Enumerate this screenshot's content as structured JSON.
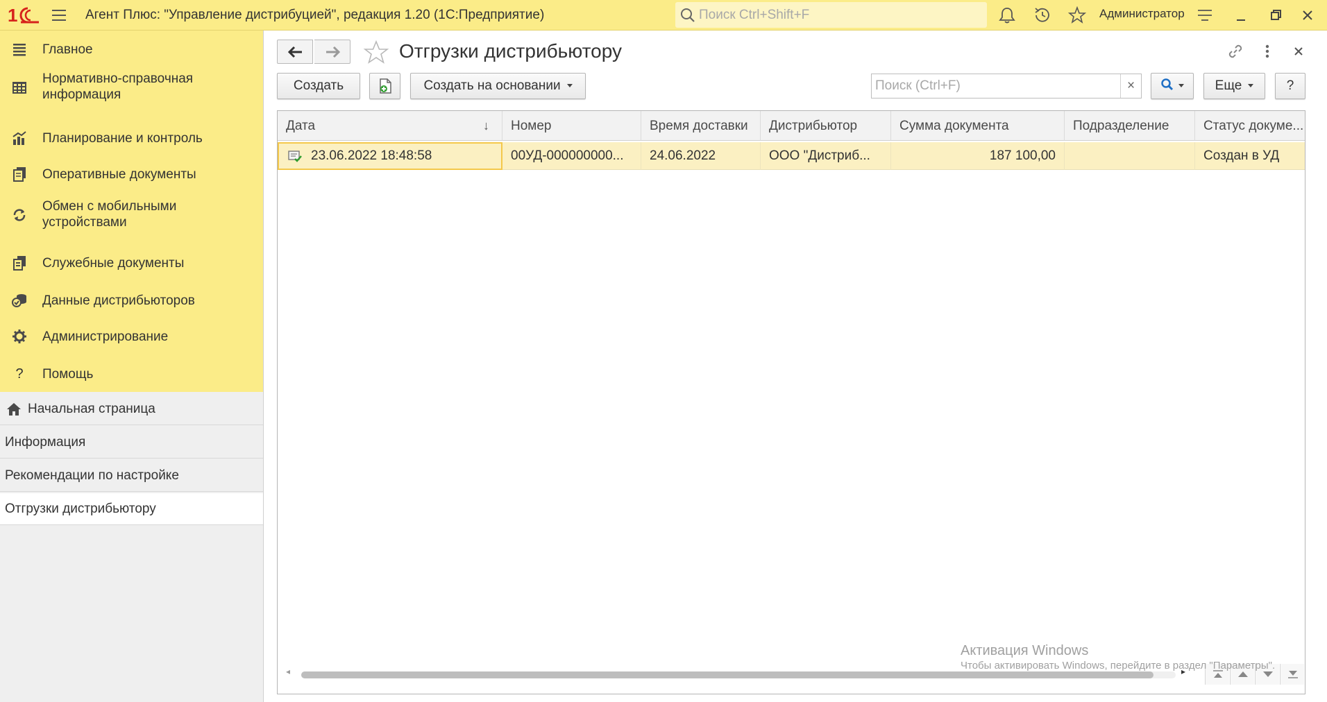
{
  "titlebar": {
    "logo_text": "1С",
    "app_title": "Агент Плюс: \"Управление дистрибуцией\", редакция 1.20  (1С:Предприятие)",
    "search_placeholder": "Поиск Ctrl+Shift+F",
    "user": "Администратор",
    "icons": [
      "menu-icon",
      "search-icon",
      "bell-icon",
      "history-icon",
      "star-icon",
      "settings-icon",
      "minimize-icon",
      "restore-icon",
      "close-icon"
    ]
  },
  "sidebar": {
    "sections": [
      {
        "label": "Главное",
        "icon": "list-icon"
      },
      {
        "label": "Нормативно-справочная информация",
        "line1": "Нормативно-справочная",
        "line2": "информация",
        "icon": "catalog-icon"
      },
      {
        "label": "Планирование и контроль",
        "icon": "chart-icon"
      },
      {
        "label": "Оперативные документы",
        "icon": "documents-icon"
      },
      {
        "label": "Обмен с мобильными устройствами",
        "line1": "Обмен с мобильными",
        "line2": "устройствами",
        "icon": "sync-icon"
      },
      {
        "label": "Служебные документы",
        "icon": "service-docs-icon"
      },
      {
        "label": "Данные дистрибьюторов",
        "icon": "distributor-data-icon"
      },
      {
        "label": "Администрирование",
        "icon": "gear-icon"
      },
      {
        "label": "Помощь",
        "icon": "help-icon"
      }
    ],
    "open_windows": [
      {
        "label": "Начальная страница",
        "icon": "home-icon"
      },
      {
        "label": "Информация"
      },
      {
        "label": "Рекомендации по настройке"
      },
      {
        "label": "Отгрузки дистрибьютору",
        "active": true
      }
    ]
  },
  "form": {
    "title": "Отгрузки дистрибьютору",
    "toolbar": {
      "create_label": "Создать",
      "create_based_label": "Создать на основании",
      "search_placeholder": "Поиск (Ctrl+F)",
      "clear_label": "×",
      "more_label": "Еще",
      "help_label": "?"
    }
  },
  "table": {
    "columns": [
      "Дата",
      "Номер",
      "Время доставки",
      "Дистрибьютор",
      "Сумма документа",
      "Подразделение",
      "Статус докуме..."
    ],
    "sort_indicator": "↓",
    "rows": [
      {
        "date": "23.06.2022 18:48:58",
        "number": "00УД-000000000...",
        "delivery_time": "24.06.2022",
        "distributor": "ООО \"Дистриб...",
        "amount": "187 100,00",
        "department": "",
        "status": "Создан в УД",
        "icon": "posted-document-icon"
      }
    ]
  },
  "watermark": {
    "line1": "Активация Windows",
    "line2": "Чтобы активировать Windows, перейдите в раздел \"Параметры\"."
  },
  "colors": {
    "accent_yellow": "#FBEC88",
    "selected_row": "#FBF0C2",
    "current_cell_border": "#F4C84A",
    "logo_red": "#D6221B"
  }
}
